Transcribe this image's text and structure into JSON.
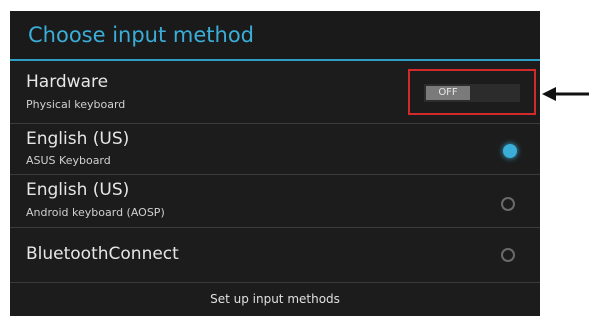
{
  "dialog": {
    "title": "Choose input method",
    "items": [
      {
        "main": "Hardware",
        "sub": "Physical keyboard",
        "control": "toggle",
        "toggle_label": "OFF"
      },
      {
        "main": "English (US)",
        "sub": "ASUS Keyboard",
        "control": "radio",
        "selected": true
      },
      {
        "main": "English (US)",
        "sub": "Android keyboard (AOSP)",
        "control": "radio",
        "selected": false
      },
      {
        "main": "BluetoothConnect",
        "sub": "",
        "control": "radio",
        "selected": false
      }
    ],
    "footer": "Set up input methods"
  },
  "colors": {
    "accent": "#3aaed8",
    "highlight_box": "#d22a2a",
    "background": "#1c1c1c"
  },
  "annotation": {
    "icon": "arrow-left-icon"
  }
}
